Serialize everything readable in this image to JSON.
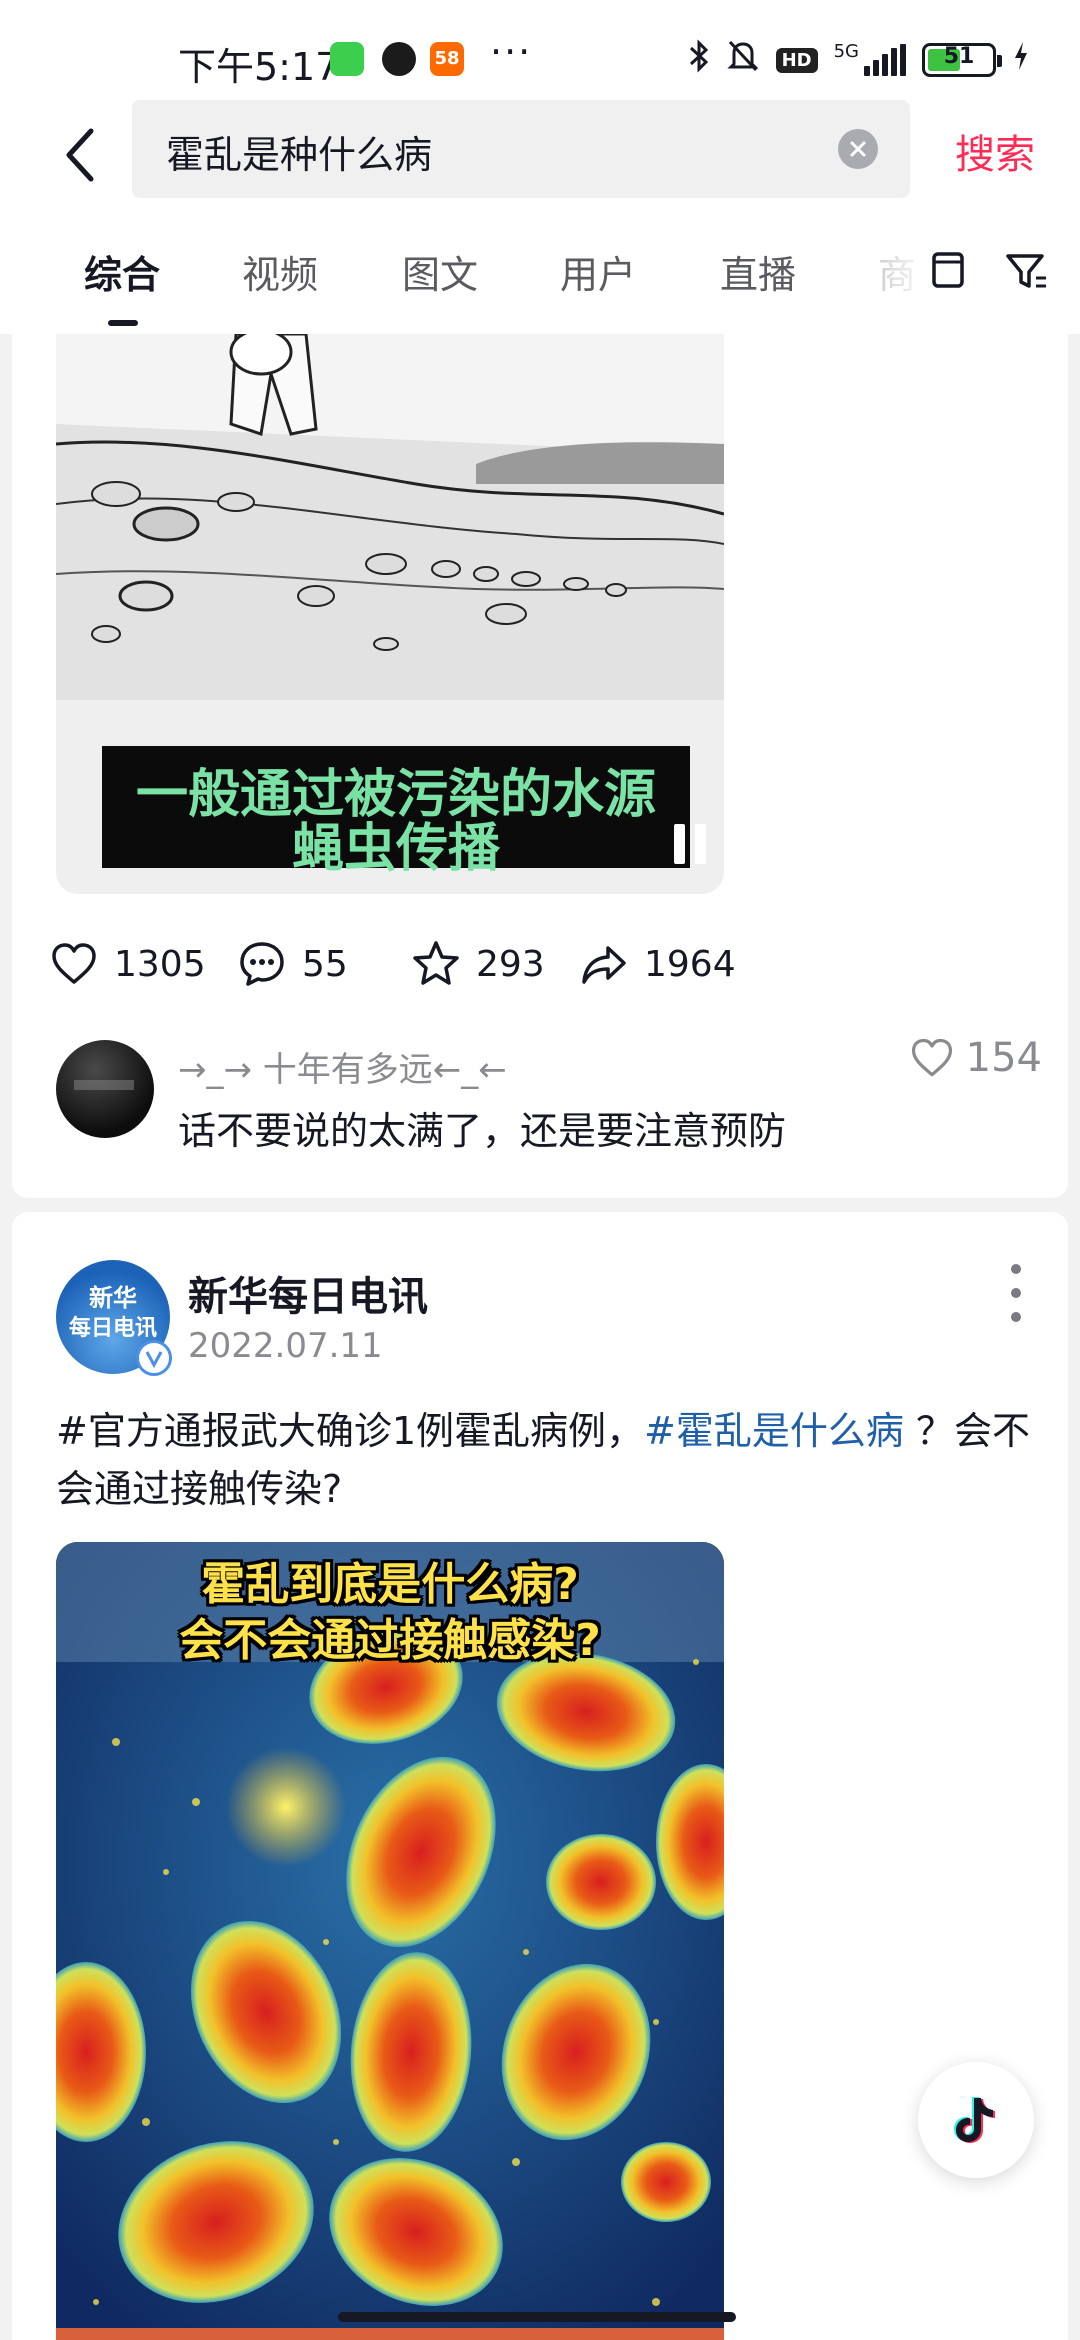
{
  "status_bar": {
    "time": "下午5:17",
    "app_58_label": "58",
    "more": "···",
    "network_label": "5G",
    "hd_label": "HD",
    "battery_level": "51",
    "battery_fraction": 0.51
  },
  "search": {
    "query": "霍乱是种什么病",
    "submit_label": "搜索"
  },
  "tabs": [
    {
      "label": "综合",
      "active": true
    },
    {
      "label": "视频",
      "active": false
    },
    {
      "label": "图文",
      "active": false
    },
    {
      "label": "用户",
      "active": false
    },
    {
      "label": "直播",
      "active": false
    },
    {
      "label": "商",
      "active": false
    }
  ],
  "card1": {
    "caption_line1": "一般通过被污染的水源",
    "caption_line2": "蝇虫传播",
    "likes": "1305",
    "comments": "55",
    "favorites": "293",
    "shares": "1964",
    "top_comment": {
      "user": "→_→ 十年有多远←_←",
      "text": "话不要说的太满了，还是要注意预防",
      "likes": "154"
    }
  },
  "card2": {
    "avatar_line1": "新华",
    "avatar_line2": "每日电讯",
    "author": "新华每日电讯",
    "date": "2022.07.11",
    "text_part1": "#官方通报武大确诊1例霍乱病例，",
    "hashtag": "#霍乱是什么病",
    "text_part2": " ？会不会通过接触传染?",
    "image_line1": "霍乱到底是什么病?",
    "image_line2": "会不会通过接触感染?"
  },
  "colors": {
    "accent": "#fe2c55",
    "hashtag": "#1f5fa8",
    "caption_green": "#7be2a6",
    "overlay_yellow": "#ffe24a",
    "battery_green": "#3ec241"
  },
  "icons": [
    "back-icon",
    "clear-icon",
    "grid-icon",
    "filter-icon",
    "heart-icon",
    "comment-icon",
    "star-icon",
    "share-icon",
    "more-icon",
    "verified-icon",
    "tiktok-icon",
    "pause-icon"
  ]
}
